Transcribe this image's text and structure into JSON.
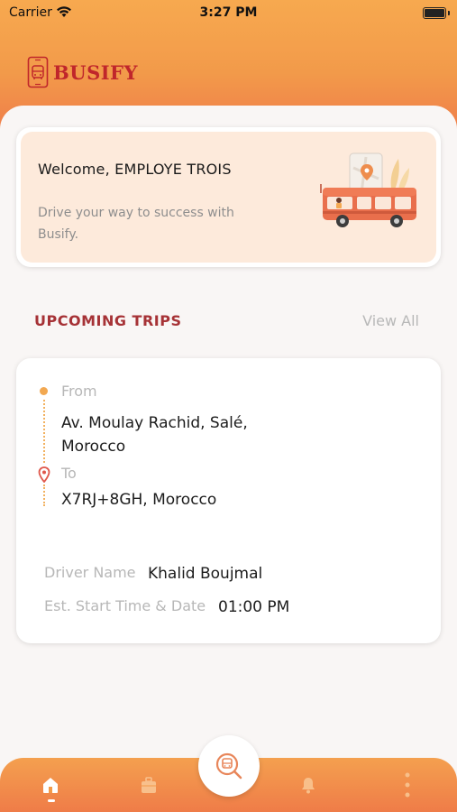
{
  "status_bar": {
    "carrier": "Carrier",
    "time": "3:27 PM"
  },
  "header": {
    "app_name": "BUSIFY"
  },
  "welcome": {
    "title": "Welcome, EMPLOYE TROIS",
    "subtitle": "Drive your way to success with Busify."
  },
  "upcoming": {
    "section_title": "UPCOMING TRIPS",
    "view_all": "View All"
  },
  "trip": {
    "from_label": "From",
    "from_value": "Av. Moulay Rachid, Salé, Morocco",
    "to_label": "To",
    "to_value": "X7RJ+8GH, Morocco",
    "driver_label": "Driver Name",
    "driver_value": "Khalid Boujmal",
    "start_label": "Est. Start Time & Date",
    "start_value": "01:00 PM"
  },
  "nav": {
    "items": [
      "home-icon",
      "briefcase-icon",
      "bus-search-icon",
      "bell-icon",
      "more-icon"
    ],
    "active": "home-icon"
  },
  "colors": {
    "brand_red": "#c0262b",
    "section_title": "#a63236",
    "accent_orange": "#f2a851",
    "header_gradient_start": "#f7a94f",
    "header_gradient_end": "#ee7a4a"
  }
}
